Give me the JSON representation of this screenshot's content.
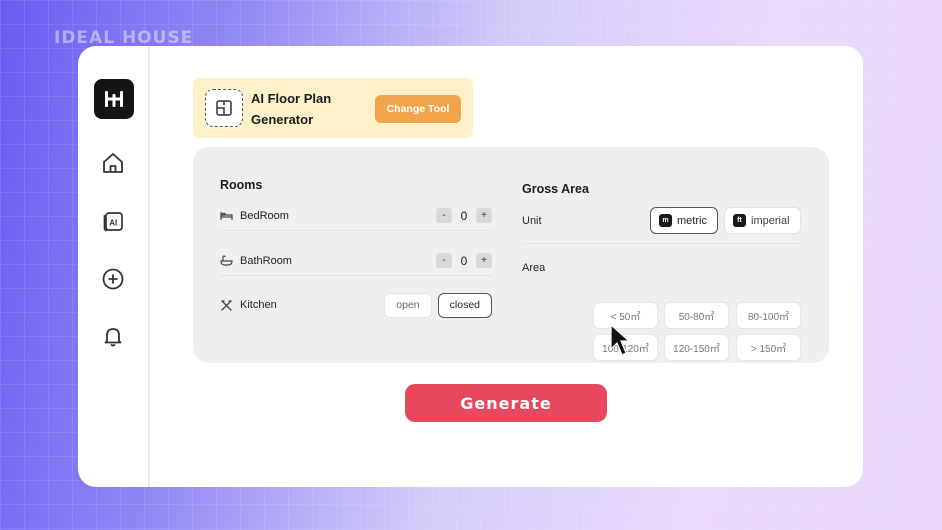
{
  "brand": "IDEAL HOUSE",
  "sidebar": {
    "logo": "logo-mark",
    "items": [
      {
        "icon": "home-icon"
      },
      {
        "icon": "ai-icon"
      },
      {
        "icon": "plus-circle-icon"
      },
      {
        "icon": "bell-icon"
      }
    ]
  },
  "tool": {
    "icon": "floor-plan-icon",
    "name": "AI Floor Plan Generator",
    "change_label": "Change Tool"
  },
  "rooms": {
    "title": "Rooms",
    "bedroom": {
      "label": "BedRoom",
      "icon": "bed-icon",
      "count": "0",
      "minus": "-",
      "plus": "+"
    },
    "bathroom": {
      "label": "BathRoom",
      "icon": "bathtub-icon",
      "count": "0",
      "minus": "-",
      "plus": "+"
    },
    "kitchen": {
      "label": "Kitchen",
      "icon": "utensils-icon",
      "options": [
        "open",
        "closed"
      ],
      "selected": "closed"
    }
  },
  "gross_area": {
    "title": "Gross Area",
    "unit_label": "Unit",
    "units": [
      {
        "label": "metric",
        "badge": "m",
        "selected": true
      },
      {
        "label": "imperial",
        "badge": "ft",
        "selected": false
      }
    ],
    "area_label": "Area",
    "areas": [
      "< 50㎡",
      "50-80㎡",
      "80-100㎡",
      "100-120㎡",
      "120-150㎡",
      "> 150㎡"
    ]
  },
  "generate_label": "Generate",
  "colors": {
    "accent": "#e8485e",
    "tool_banner": "#fdf1c9",
    "change_button": "#f1a44c"
  }
}
